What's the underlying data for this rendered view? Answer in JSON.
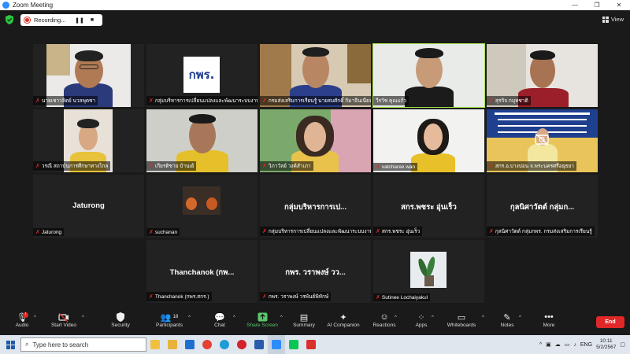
{
  "window": {
    "title": "Zoom Meeting",
    "controls": [
      "—",
      "❐",
      "✕"
    ]
  },
  "recording": {
    "label": "Recording...",
    "pause": "❚❚",
    "stop": "■"
  },
  "view_label": "View",
  "tiles": [
    {
      "caption": "นายเชาวลิตย์ นวลพุดซา",
      "muted": true
    },
    {
      "caption": "กลุ่มบริหารการเปลี่ยนแปลงและพัฒนาระบบงาน",
      "muted": true,
      "logo": "กพร."
    },
    {
      "caption": "กรมส่งเสริมการเรียนรู้ นายสมศักดิ์ กิมาจีนเนียม",
      "muted": true
    },
    {
      "caption": "วีรวัช คุณแก้ว",
      "muted": false,
      "active": true
    },
    {
      "caption": "สุรกิจ กมุทชาติ",
      "muted": true
    },
    {
      "caption": "วรณี สถาบันการศึกษาทางไกล",
      "muted": true
    },
    {
      "caption": "เกียรติชาย บ้านเย้",
      "muted": true
    },
    {
      "caption": "วิภาวัลย์ วงค์สำเภา",
      "muted": true
    },
    {
      "caption": "vatcharee wan",
      "muted": true
    },
    {
      "caption": "สกร.อ.บางบ่อน จ.พระนครศรีอยุธยา",
      "muted": true
    },
    {
      "caption": "Jaturong",
      "muted": true,
      "name": "Jaturong"
    },
    {
      "caption": "suchanan",
      "muted": true
    },
    {
      "caption": "กลุ่มบริหารการเปลี่ยนแปลงและพัฒนาระบบงาน",
      "muted": true,
      "name": "กลุ่มบริหารการเป..."
    },
    {
      "caption": "สกร.พชระ อุ่นเร็ว",
      "muted": true,
      "name": "สกร.พชระ อุ่นเร็ว"
    },
    {
      "caption": "กุลนิศาวัตต์ กลุ่มกพร. กรมส่งเสริมการเรียนรู้",
      "muted": true,
      "name": "กุลนิศาวัตต์ กลุ่มก..."
    },
    {
      "caption": "Thanchanok (กพร.สกร.)",
      "muted": true,
      "name": "Thanchanok (กพ..."
    },
    {
      "caption": "กพร. วราพงษ์ วรพันธ์พิทักษ์",
      "muted": true,
      "name": "กพร. วราพงษ์ วว..."
    },
    {
      "caption": "Sutinee Lochaiyakul",
      "muted": true
    }
  ],
  "toolbar": {
    "audio": "Audio",
    "audio_badge": "!",
    "video": "Start Video",
    "security": "Security",
    "participants": "Participants",
    "participants_count": "18",
    "chat": "Chat",
    "share": "Share Screen",
    "summary": "Summary",
    "ai": "AI Companion",
    "reactions": "Reactions",
    "apps": "Apps",
    "whiteboards": "Whiteboards",
    "notes": "Notes",
    "more": "More",
    "end": "End"
  },
  "taskbar": {
    "search_placeholder": "Type here to search",
    "lang": "ENG",
    "time": "10:11",
    "date": "5/2/2567"
  },
  "colors": {
    "accent": "#2d8cff",
    "active_border": "#a7e24e",
    "end": "#e02828",
    "share": "#58c86a"
  }
}
